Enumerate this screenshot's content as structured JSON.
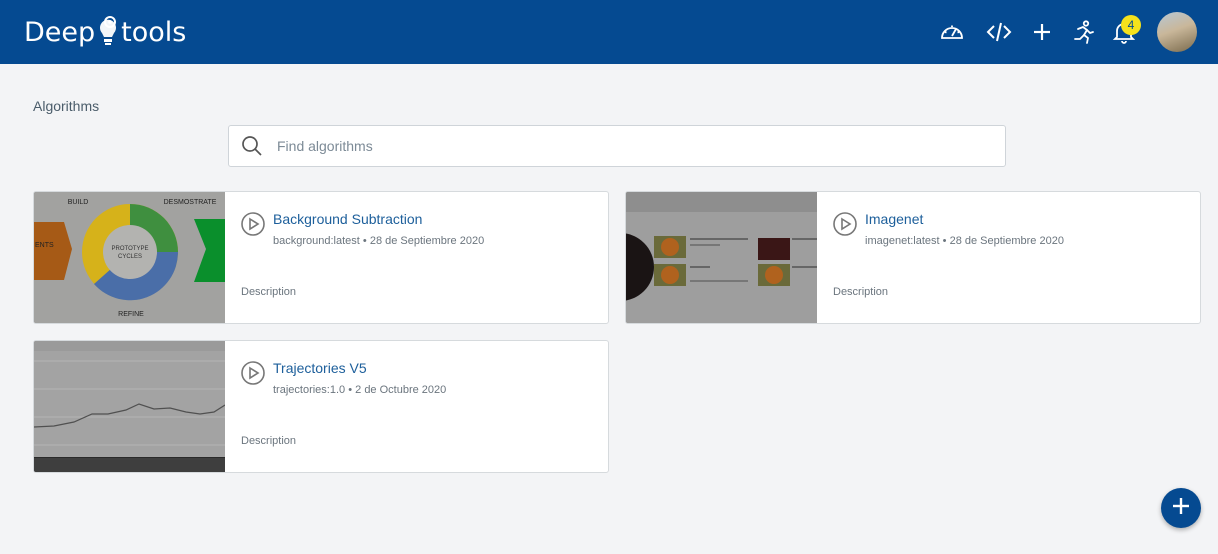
{
  "header": {
    "logo_left": "Deep",
    "logo_right": "tools",
    "icons": [
      "dashboard-icon",
      "code-icon",
      "plus-icon",
      "running-icon",
      "bell-icon"
    ],
    "notification_count": "4"
  },
  "breadcrumb": "Algorithms",
  "search": {
    "placeholder": "Find algorithms",
    "value": ""
  },
  "cards": [
    {
      "title": "Background Subtraction",
      "image": "background:latest",
      "date": "28 de Septiembre 2020",
      "description": "Description",
      "thumb_labels": [
        "BUILD",
        "DESMOSTRATE",
        "PROTOTYPE",
        "CYCLES",
        "REFINE",
        "ENTS"
      ]
    },
    {
      "title": "Imagenet",
      "image": "imagenet:latest",
      "date": "28 de Septiembre 2020",
      "description": "Description"
    },
    {
      "title": "Trajectories V5",
      "image": "trajectories:1.0",
      "date": "2 de Octubre 2020",
      "description": "Description"
    }
  ],
  "meta_separator": "•",
  "colors": {
    "primary": "#054a91",
    "badge": "#f6e21c",
    "link": "#1d5f9b"
  }
}
